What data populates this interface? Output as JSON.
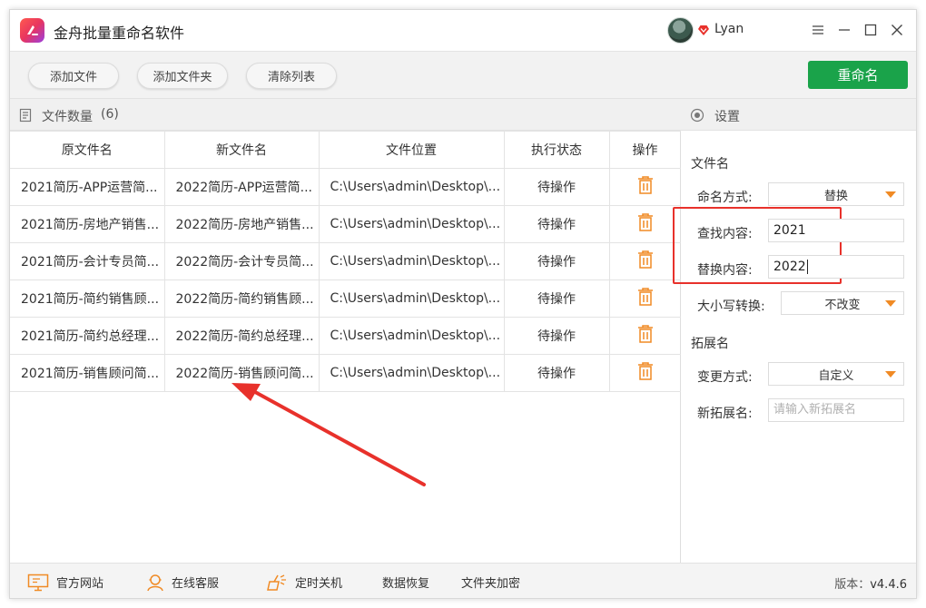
{
  "app": {
    "title": "金舟批量重命名软件",
    "username": "Lyan"
  },
  "toolbar": {
    "add_file": "添加文件",
    "add_folder": "添加文件夹",
    "clear_list": "清除列表",
    "rename": "重命名"
  },
  "file_panel": {
    "count_label": "文件数量",
    "count_value": "(6)",
    "columns": [
      "原文件名",
      "新文件名",
      "文件位置",
      "执行状态",
      "操作"
    ],
    "rows": [
      {
        "original": "2021简历-APP运营简...",
        "new_name": "2022简历-APP运营简...",
        "location": "C:\\Users\\admin\\Desktop\\...",
        "status": "待操作"
      },
      {
        "original": "2021简历-房地产销售...",
        "new_name": "2022简历-房地产销售...",
        "location": "C:\\Users\\admin\\Desktop\\...",
        "status": "待操作"
      },
      {
        "original": "2021简历-会计专员简...",
        "new_name": "2022简历-会计专员简...",
        "location": "C:\\Users\\admin\\Desktop\\...",
        "status": "待操作"
      },
      {
        "original": "2021简历-简约销售顾...",
        "new_name": "2022简历-简约销售顾...",
        "location": "C:\\Users\\admin\\Desktop\\...",
        "status": "待操作"
      },
      {
        "original": "2021简历-简约总经理...",
        "new_name": "2022简历-简约总经理...",
        "location": "C:\\Users\\admin\\Desktop\\...",
        "status": "待操作"
      },
      {
        "original": "2021简历-销售顾问简...",
        "new_name": "2022简历-销售顾问简...",
        "location": "C:\\Users\\admin\\Desktop\\...",
        "status": "待操作"
      }
    ]
  },
  "settings": {
    "title": "设置",
    "filename_section": "文件名",
    "naming_mode_label": "命名方式:",
    "naming_mode_value": "替换",
    "find_label": "查找内容:",
    "find_value": "2021",
    "replace_label": "替换内容:",
    "replace_value": "2022",
    "case_label": "大小写转换:",
    "case_value": "不改变",
    "ext_section": "拓展名",
    "ext_mode_label": "变更方式:",
    "ext_mode_value": "自定义",
    "new_ext_label": "新拓展名:",
    "new_ext_placeholder": "请输入新拓展名"
  },
  "footer": {
    "website": "官方网站",
    "support": "在线客服",
    "shutdown": "定时关机",
    "recovery": "数据恢复",
    "encrypt": "文件夹加密",
    "version_label": "版本：",
    "version_value": "v4.4.6"
  },
  "colors": {
    "accent_green": "#1aa34a",
    "accent_orange": "#f08a24",
    "annotation_red": "#e8312b"
  }
}
